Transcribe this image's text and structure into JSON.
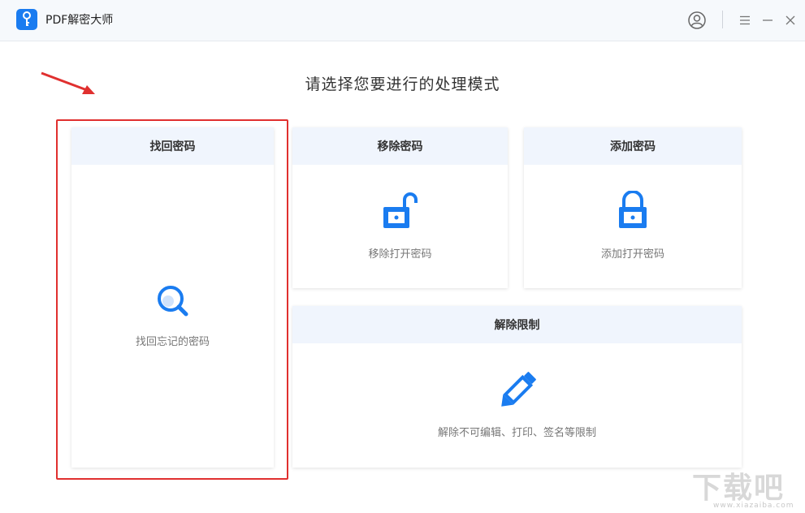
{
  "app": {
    "title": "PDF解密大师",
    "logo_icon": "key-icon",
    "accent_color": "#1a7cf0"
  },
  "window_controls": [
    {
      "name": "user-account-icon"
    },
    {
      "name": "menu-icon"
    },
    {
      "name": "minimize-icon"
    },
    {
      "name": "close-icon"
    }
  ],
  "main": {
    "heading": "请选择您要进行的处理模式",
    "cards": {
      "recover": {
        "title": "找回密码",
        "description": "找回忘记的密码",
        "icon": "magnifier-icon"
      },
      "remove": {
        "title": "移除密码",
        "description": "移除打开密码",
        "icon": "unlocked-padlock-icon"
      },
      "add": {
        "title": "添加密码",
        "description": "添加打开密码",
        "icon": "locked-padlock-icon"
      },
      "unrestrict": {
        "title": "解除限制",
        "description": "解除不可编辑、打印、签名等限制",
        "icon": "pencil-icon"
      }
    },
    "annotation_color": "#e0302f"
  },
  "watermark": {
    "text": "下载吧",
    "url_text": "www.xiazaiba.com"
  }
}
